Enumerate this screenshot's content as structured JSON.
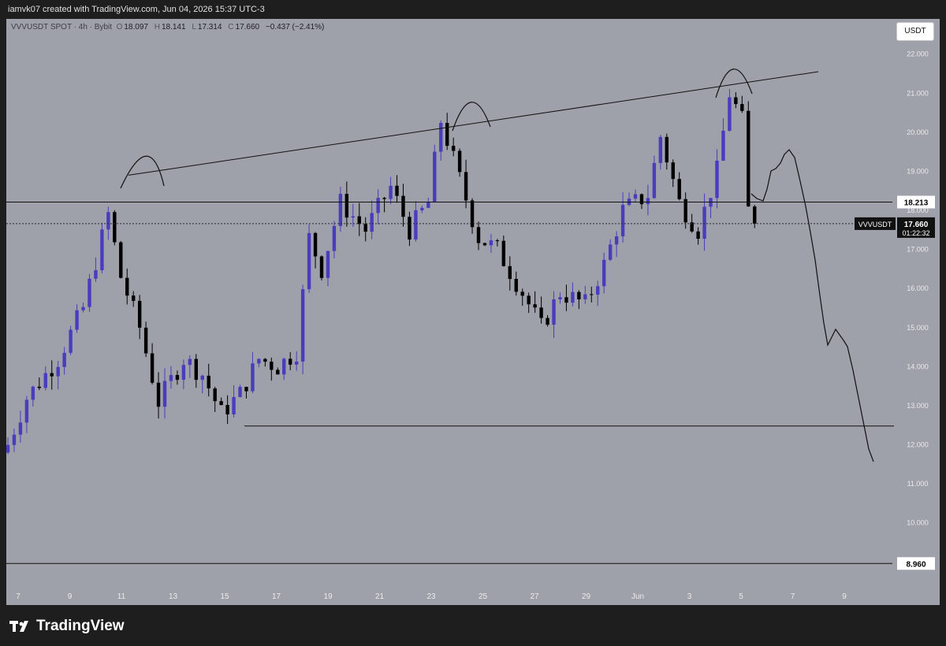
{
  "header": {
    "caption": "iamvk07 created with TradingView.com, Jun 04, 2026 15:37 UTC-3"
  },
  "legend": {
    "symbol": "VVVUSDT SPOT · 4h · Bybit",
    "open_label": "O",
    "open": "18.097",
    "high_label": "H",
    "high": "18.141",
    "low_label": "L",
    "low": "17.314",
    "close_label": "C",
    "close": "17.660",
    "change": "−0.437 (−2.41%)"
  },
  "currency_button": "USDT",
  "footer": {
    "brand": "TradingView"
  },
  "colors": {
    "background": "#9ea0aa",
    "up": "#4a3dbd",
    "down": "#000000",
    "axis_text": "#ececec",
    "line": "#111111"
  },
  "chart_data": {
    "type": "candlestick",
    "symbol": "VVVUSDT",
    "interval": "4h",
    "y_range": [
      8.3,
      22.7
    ],
    "y_ticks": [
      "22.000",
      "21.000",
      "20.000",
      "19.000",
      "18.000",
      "17.000",
      "16.000",
      "15.000",
      "14.000",
      "13.000",
      "12.000",
      "11.000",
      "10.000"
    ],
    "x_ticks": [
      "7",
      "9",
      "11",
      "13",
      "15",
      "17",
      "19",
      "21",
      "23",
      "25",
      "27",
      "29",
      "Jun",
      "3",
      "5",
      "7",
      "9"
    ],
    "labels": {
      "last_price": "17.660",
      "last_symbol": "VVVUSDT",
      "countdown": "01:22:32",
      "resistance": "18.213",
      "low_level": "8.960"
    },
    "levels": {
      "resistance": 18.213,
      "support": 12.48,
      "low": 8.96,
      "last": 17.66
    },
    "trendline": [
      [
        0.0,
        18.9
      ],
      [
        1.0,
        21.55
      ]
    ],
    "anchors": [
      [
        0,
        12.0
      ],
      [
        3,
        13.2
      ],
      [
        8,
        14.2
      ],
      [
        12,
        15.5
      ],
      [
        16,
        17.9
      ],
      [
        18,
        16.3
      ],
      [
        21,
        15.0
      ],
      [
        24,
        13.1
      ],
      [
        28,
        14.2
      ],
      [
        31,
        13.8
      ],
      [
        34,
        12.8
      ],
      [
        37,
        13.3
      ],
      [
        40,
        14.2
      ],
      [
        43,
        14.0
      ],
      [
        46,
        14.4
      ],
      [
        48,
        17.3
      ],
      [
        50,
        16.5
      ],
      [
        53,
        18.2
      ],
      [
        57,
        17.5
      ],
      [
        61,
        18.6
      ],
      [
        64,
        17.5
      ],
      [
        67,
        18.2
      ],
      [
        69,
        20.3
      ],
      [
        72,
        18.8
      ],
      [
        75,
        17.3
      ],
      [
        78,
        17.0
      ],
      [
        82,
        15.9
      ],
      [
        85,
        15.0
      ],
      [
        88,
        15.9
      ],
      [
        92,
        15.6
      ],
      [
        95,
        16.6
      ],
      [
        98,
        18.0
      ],
      [
        102,
        18.4
      ],
      [
        104,
        19.9
      ],
      [
        107,
        18.2
      ],
      [
        110,
        17.5
      ],
      [
        113,
        19.0
      ],
      [
        115,
        21.0
      ],
      [
        117,
        20.3
      ],
      [
        118,
        18.0
      ],
      [
        119,
        17.66
      ]
    ],
    "projection": [
      [
        953,
        246
      ],
      [
        960,
        252
      ],
      [
        968,
        255
      ],
      [
        973,
        240
      ],
      [
        978,
        217
      ],
      [
        984,
        214
      ],
      [
        990,
        207
      ],
      [
        995,
        196
      ],
      [
        1001,
        190
      ],
      [
        1008,
        200
      ],
      [
        1015,
        230
      ],
      [
        1022,
        262
      ],
      [
        1028,
        295
      ],
      [
        1034,
        330
      ],
      [
        1040,
        375
      ],
      [
        1045,
        410
      ],
      [
        1050,
        438
      ],
      [
        1055,
        428
      ],
      [
        1060,
        418
      ],
      [
        1065,
        425
      ],
      [
        1070,
        432
      ],
      [
        1075,
        440
      ],
      [
        1082,
        470
      ],
      [
        1090,
        510
      ],
      [
        1097,
        545
      ],
      [
        1102,
        570
      ],
      [
        1108,
        586
      ]
    ],
    "annotations": "hand-drawn arcs over three swing highs; projected down-path to ~11.8"
  }
}
